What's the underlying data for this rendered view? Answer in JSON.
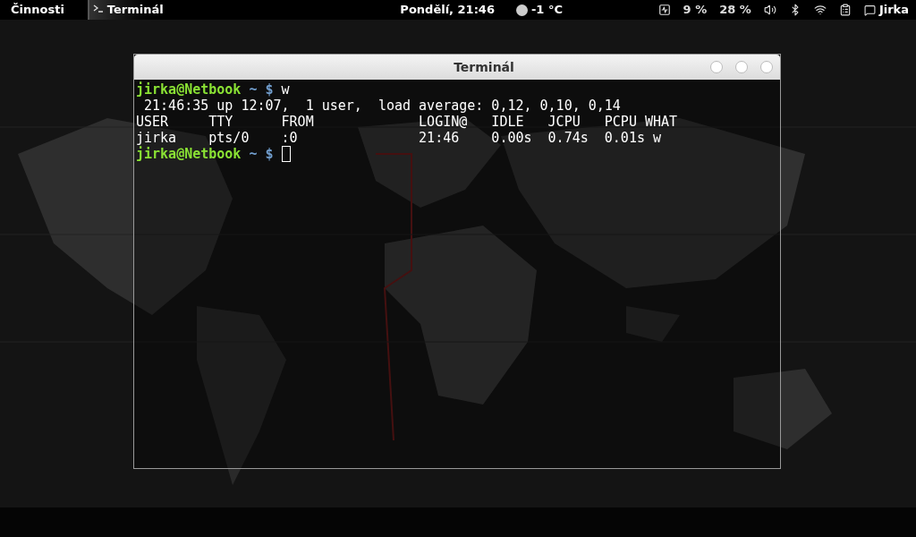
{
  "top_bar": {
    "activities": "Činnosti",
    "app_menu": "Terminál",
    "clock": "Pondělí, 21:46",
    "weather": "-1 °C",
    "cpu": "9 %",
    "memory": "28 %",
    "user": "Jirka"
  },
  "window": {
    "title": "Terminál",
    "lines": [
      {
        "kind": "prompt",
        "user": "jirka@Netbook",
        "path": "~ $",
        "command": "w",
        "cursor": false
      },
      {
        "kind": "output",
        "text": " 21:46:35 up 12:07,  1 user,  load average: 0,12, 0,10, 0,14"
      },
      {
        "kind": "output",
        "text": "USER     TTY      FROM             LOGIN@   IDLE   JCPU   PCPU WHAT"
      },
      {
        "kind": "output",
        "text": "jirka    pts/0    :0               21:46    0.00s  0.74s  0.01s w"
      },
      {
        "kind": "prompt",
        "user": "jirka@Netbook",
        "path": "~ $",
        "cursor": true
      }
    ]
  }
}
